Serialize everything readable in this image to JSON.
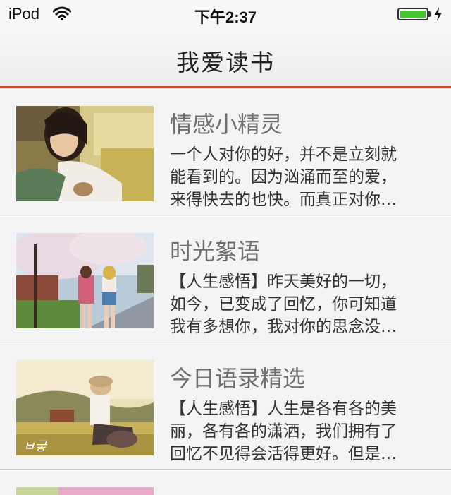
{
  "status_bar": {
    "carrier": "iPod",
    "time": "下午2:37",
    "battery_level": 1.0
  },
  "nav": {
    "title": "我爱读书"
  },
  "colors": {
    "accent": "#c8493a",
    "battery": "#43c42e"
  },
  "articles": [
    {
      "title": "情感小精灵",
      "lines": [
        "一个人对你的好，并不是立刻就",
        "能看到的。因为汹涌而至的爱，",
        "来得快去的也快。而真正对你…"
      ],
      "image": "girl-on-yellow-sofa"
    },
    {
      "title": "时光絮语",
      "lines": [
        "【人生感悟】昨天美好的一切，",
        "如今，已变成了回忆，你可知道",
        "我有多想你，我对你的思念没…"
      ],
      "image": "girls-under-cherry-blossoms"
    },
    {
      "title": "今日语录精选",
      "lines": [
        "【人生感悟】人生是各有各的美",
        "丽，各有各的潇洒，我们拥有了",
        "回忆不见得会活得更好。但是…"
      ],
      "image": "girl-sitting-on-grass"
    }
  ]
}
